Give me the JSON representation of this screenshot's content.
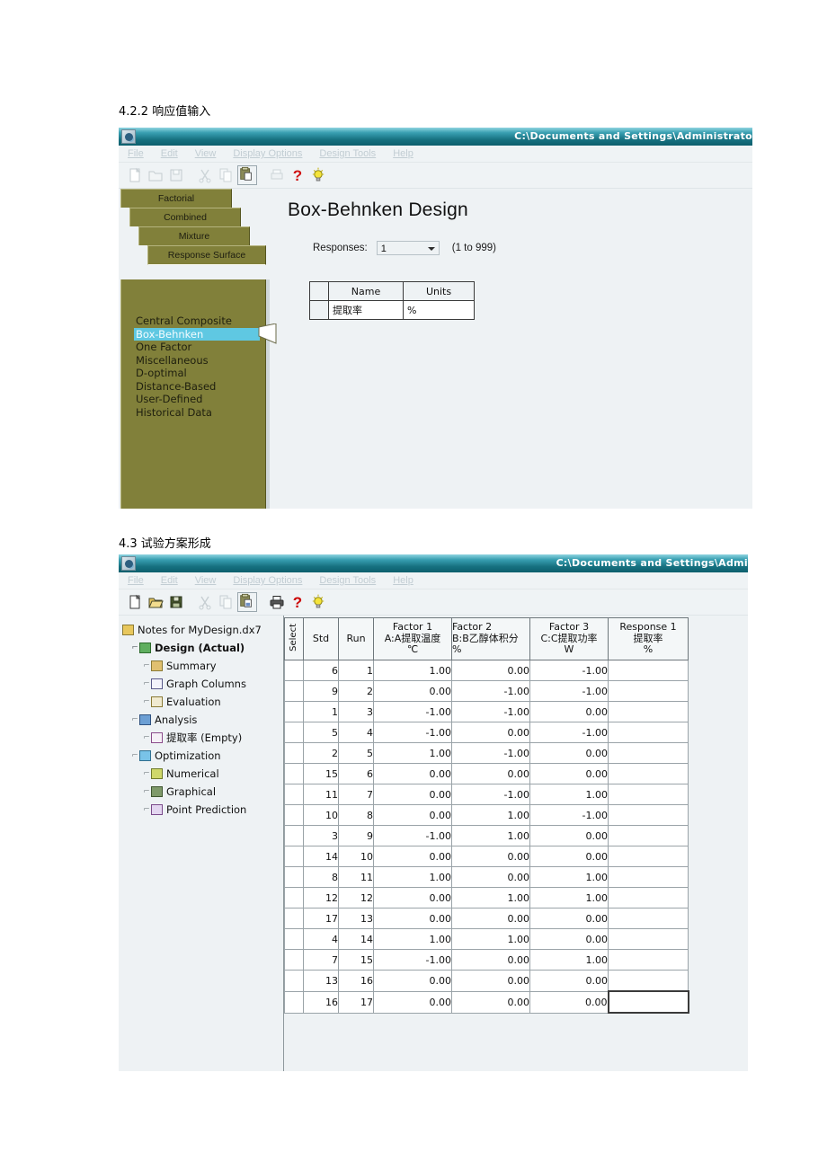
{
  "doc": {
    "heading_422": "4.2.2 响应值输入",
    "heading_43": "4.3 试验方案形成"
  },
  "window1": {
    "title": "C:\\Documents and Settings\\Administrato",
    "menu": [
      "File",
      "Edit",
      "View",
      "Display Options",
      "Design Tools",
      "Help"
    ],
    "toolbar_icons": [
      "new-document-icon",
      "open-folder-icon",
      "save-disk-icon",
      "cut-scissors-icon",
      "copy-icon",
      "paste-icon",
      "print-icon",
      "help-question-icon",
      "tip-lightbulb-icon"
    ],
    "tabs": [
      "Factorial",
      "Combined",
      "Mixture",
      "Response Surface"
    ],
    "design_list": [
      "Central Composite",
      "Box-Behnken",
      "One Factor",
      "Miscellaneous",
      "D-optimal",
      "Distance-Based",
      "User-Defined",
      "Historical Data"
    ],
    "selected_design": "Box-Behnken",
    "page_title": "Box-Behnken Design",
    "responses_label": "Responses:",
    "responses_value": "1",
    "responses_range": "(1 to 999)",
    "response_table": {
      "headers": [
        "Name",
        "Units"
      ],
      "rows": [
        {
          "name": "提取率",
          "units": "%"
        }
      ]
    },
    "colors": {
      "titlebar": "#16707f",
      "panel": "#81803a",
      "selection": "#5fc8e2",
      "window_bg": "#eef2f4"
    }
  },
  "window2": {
    "title": "C:\\Documents and Settings\\Admi",
    "menu": [
      "File",
      "Edit",
      "View",
      "Display Options",
      "Design Tools",
      "Help"
    ],
    "toolbar_icons": [
      "new-document-icon",
      "open-folder-icon",
      "save-disk-icon",
      "cut-scissors-icon",
      "copy-icon",
      "paste-icon",
      "print-icon",
      "help-question-icon",
      "tip-lightbulb-icon"
    ],
    "tree": [
      {
        "label": "Notes for MyDesign.dx7",
        "level": 1,
        "icon": "folder-icon",
        "bold": false
      },
      {
        "label": "Design (Actual)",
        "level": 2,
        "icon": "design-grid-icon",
        "bold": true
      },
      {
        "label": "Summary",
        "level": 3,
        "icon": "summary-icon",
        "bold": false
      },
      {
        "label": "Graph Columns",
        "level": 3,
        "icon": "graph-columns-icon",
        "bold": false
      },
      {
        "label": "Evaluation",
        "level": 3,
        "icon": "evaluation-magnifier-icon",
        "bold": false
      },
      {
        "label": "Analysis",
        "level": 2,
        "icon": "analysis-icon",
        "bold": false
      },
      {
        "label": "提取率 (Empty)",
        "level": 3,
        "icon": "response-thermometer-icon",
        "bold": false
      },
      {
        "label": "Optimization",
        "level": 2,
        "icon": "optimization-icon",
        "bold": false
      },
      {
        "label": "Numerical",
        "level": 3,
        "icon": "numerical-icon",
        "bold": false
      },
      {
        "label": "Graphical",
        "level": 3,
        "icon": "graphical-icon",
        "bold": false
      },
      {
        "label": "Point Prediction",
        "level": 3,
        "icon": "point-prediction-icon",
        "bold": false
      }
    ],
    "grid": {
      "headers": [
        {
          "key": "select",
          "line1": "Select",
          "line2": "",
          "line3": ""
        },
        {
          "key": "std",
          "line1": "Std",
          "line2": "",
          "line3": ""
        },
        {
          "key": "run",
          "line1": "Run",
          "line2": "",
          "line3": ""
        },
        {
          "key": "f1",
          "line1": "Factor 1",
          "line2": "A:A提取温度",
          "line3": "℃"
        },
        {
          "key": "f2",
          "line1": "Factor 2",
          "line2": "B:B乙醇体积分",
          "line3": "%"
        },
        {
          "key": "f3",
          "line1": "Factor 3",
          "line2": "C:C提取功率",
          "line3": "W"
        },
        {
          "key": "r1",
          "line1": "Response 1",
          "line2": "提取率",
          "line3": "%"
        }
      ],
      "rows": [
        {
          "std": "6",
          "run": "1",
          "f1": "1.00",
          "f2": "0.00",
          "f3": "-1.00",
          "r1": ""
        },
        {
          "std": "9",
          "run": "2",
          "f1": "0.00",
          "f2": "-1.00",
          "f3": "-1.00",
          "r1": ""
        },
        {
          "std": "1",
          "run": "3",
          "f1": "-1.00",
          "f2": "-1.00",
          "f3": "0.00",
          "r1": ""
        },
        {
          "std": "5",
          "run": "4",
          "f1": "-1.00",
          "f2": "0.00",
          "f3": "-1.00",
          "r1": ""
        },
        {
          "std": "2",
          "run": "5",
          "f1": "1.00",
          "f2": "-1.00",
          "f3": "0.00",
          "r1": ""
        },
        {
          "std": "15",
          "run": "6",
          "f1": "0.00",
          "f2": "0.00",
          "f3": "0.00",
          "r1": ""
        },
        {
          "std": "11",
          "run": "7",
          "f1": "0.00",
          "f2": "-1.00",
          "f3": "1.00",
          "r1": ""
        },
        {
          "std": "10",
          "run": "8",
          "f1": "0.00",
          "f2": "1.00",
          "f3": "-1.00",
          "r1": ""
        },
        {
          "std": "3",
          "run": "9",
          "f1": "-1.00",
          "f2": "1.00",
          "f3": "0.00",
          "r1": ""
        },
        {
          "std": "14",
          "run": "10",
          "f1": "0.00",
          "f2": "0.00",
          "f3": "0.00",
          "r1": ""
        },
        {
          "std": "8",
          "run": "11",
          "f1": "1.00",
          "f2": "0.00",
          "f3": "1.00",
          "r1": ""
        },
        {
          "std": "12",
          "run": "12",
          "f1": "0.00",
          "f2": "1.00",
          "f3": "1.00",
          "r1": ""
        },
        {
          "std": "17",
          "run": "13",
          "f1": "0.00",
          "f2": "0.00",
          "f3": "0.00",
          "r1": ""
        },
        {
          "std": "4",
          "run": "14",
          "f1": "1.00",
          "f2": "1.00",
          "f3": "0.00",
          "r1": ""
        },
        {
          "std": "7",
          "run": "15",
          "f1": "-1.00",
          "f2": "0.00",
          "f3": "1.00",
          "r1": ""
        },
        {
          "std": "13",
          "run": "16",
          "f1": "0.00",
          "f2": "0.00",
          "f3": "0.00",
          "r1": ""
        },
        {
          "std": "16",
          "run": "17",
          "f1": "0.00",
          "f2": "0.00",
          "f3": "0.00",
          "r1": ""
        }
      ],
      "focused_cell": {
        "row": 16,
        "column": "r1"
      }
    }
  }
}
